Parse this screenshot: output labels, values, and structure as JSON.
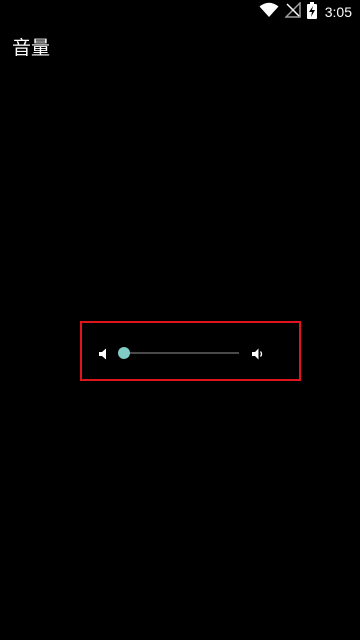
{
  "status_bar": {
    "time": "3:05",
    "icons": [
      "wifi-icon",
      "no-signal-icon",
      "battery-charging-icon"
    ]
  },
  "page": {
    "title": "音量"
  },
  "volume": {
    "level": 0.0,
    "min_icon": "volume-mute-icon",
    "max_icon": "volume-up-icon",
    "accent_color": "#80cbc4",
    "highlight_color": "#e0141c"
  }
}
